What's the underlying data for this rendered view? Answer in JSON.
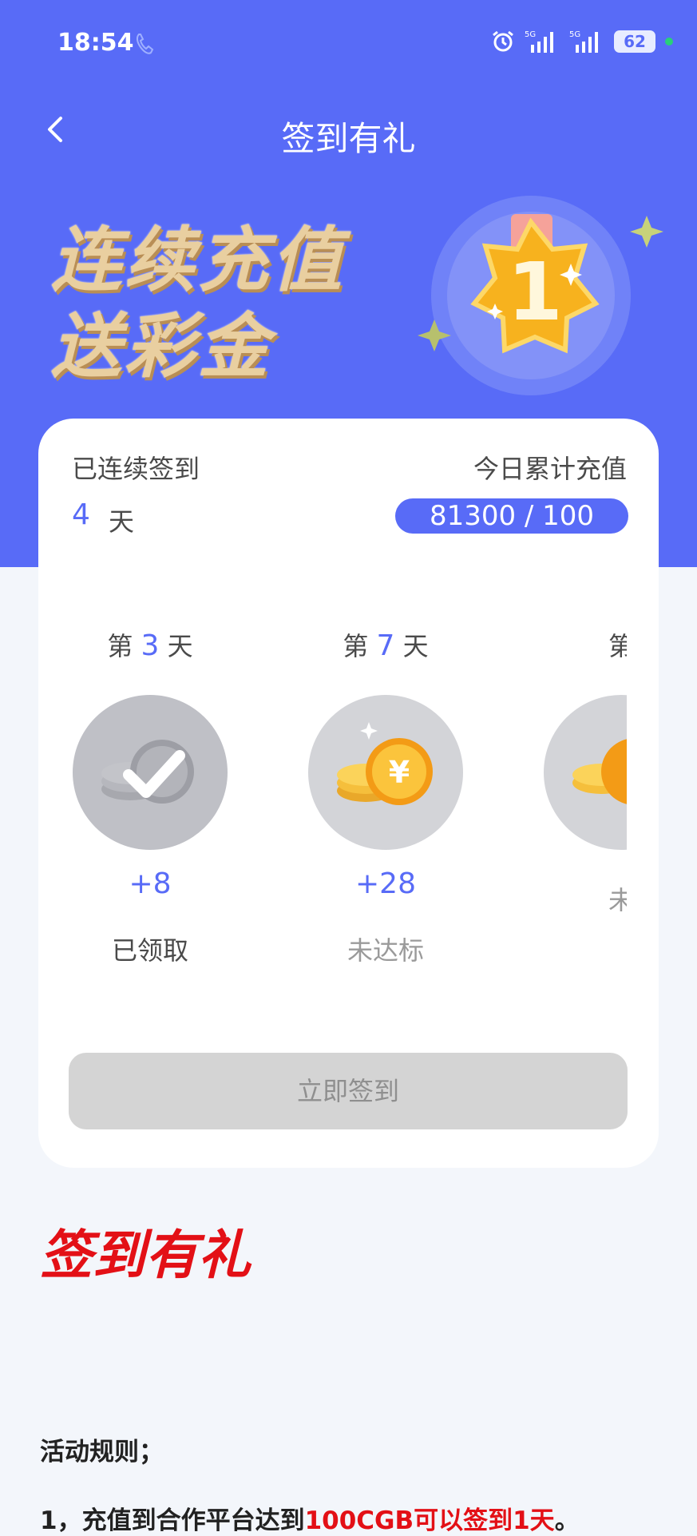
{
  "status_bar": {
    "time": "18:54",
    "battery": "62"
  },
  "nav": {
    "title": "签到有礼"
  },
  "banner": {
    "line1": "连续充值",
    "line2": "送彩金",
    "medal_number": "1"
  },
  "card": {
    "streak_label": "已连续签到",
    "streak_value": "4",
    "streak_unit": "天",
    "today_label": "今日累计充值",
    "today_progress": "81300 / 100"
  },
  "days": [
    {
      "prefix": "第",
      "num": "3",
      "suffix": "天",
      "reward": "+8",
      "state": "已领取"
    },
    {
      "prefix": "第",
      "num": "7",
      "suffix": "天",
      "reward": "+28",
      "state": "未达标"
    },
    {
      "prefix": "第",
      "num": "",
      "suffix": "",
      "reward": "",
      "state": "未"
    }
  ],
  "signin_button": "立即签到",
  "section_title": "签到有礼",
  "rules": {
    "title": "活动规则；",
    "line1_prefix": "1，充值到合作平台达到",
    "line1_highlight": "100CGB可以签到1天",
    "line1_suffix": "。"
  },
  "colors": {
    "primary": "#586bf7",
    "highlight": "#e31016",
    "background": "#f3f6fb"
  }
}
